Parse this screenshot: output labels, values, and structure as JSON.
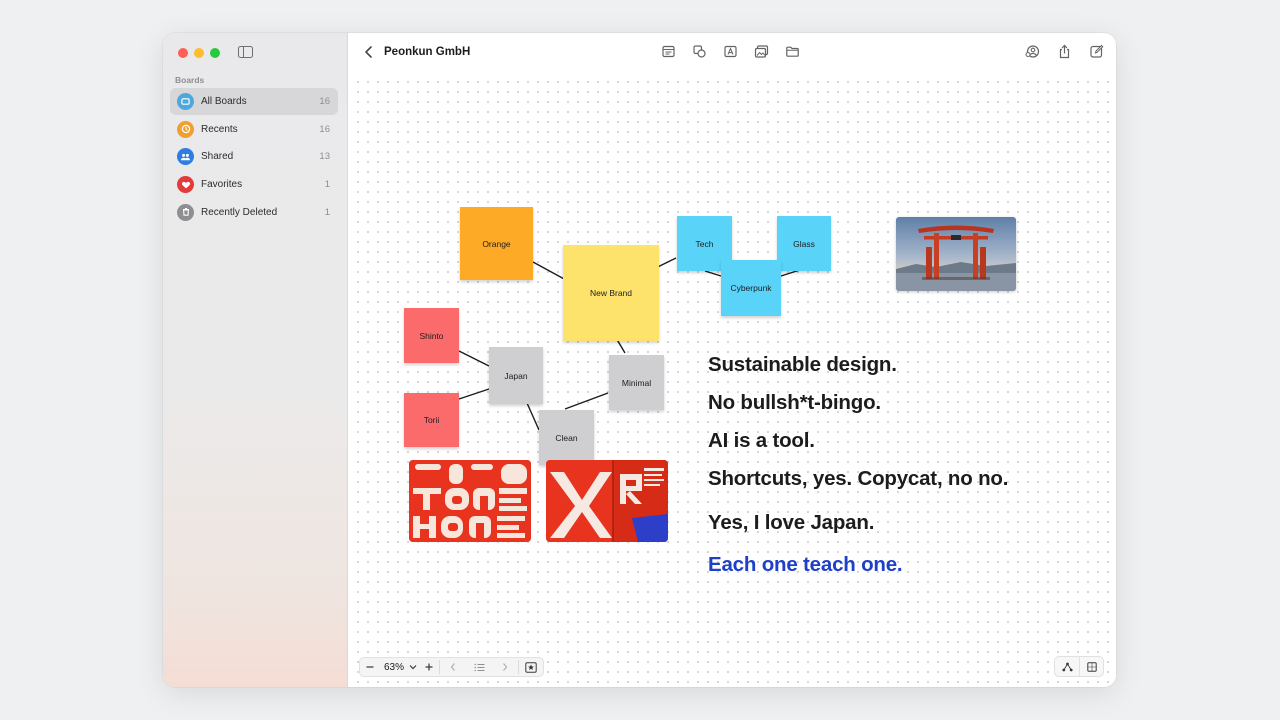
{
  "sidebar": {
    "section_label": "Boards",
    "items": [
      {
        "label": "All Boards",
        "count": "16",
        "icon": "all-boards-icon",
        "color": "#4ea8de"
      },
      {
        "label": "Recents",
        "count": "16",
        "icon": "clock-icon",
        "color": "#f0a030"
      },
      {
        "label": "Shared",
        "count": "13",
        "icon": "people-icon",
        "color": "#2f7de1"
      },
      {
        "label": "Favorites",
        "count": "1",
        "icon": "heart-icon",
        "color": "#e23b3b"
      },
      {
        "label": "Recently Deleted",
        "count": "1",
        "icon": "trash-icon",
        "color": "#8e8e93"
      }
    ]
  },
  "toolbar": {
    "title": "Peonkun GmbH"
  },
  "canvas": {
    "notes": {
      "orange": "Orange",
      "new_brand": "New Brand",
      "tech": "Tech",
      "glass": "Glass",
      "cyberpunk": "Cyberpunk",
      "shinto": "Shinto",
      "japan": "Japan",
      "minimal": "Minimal",
      "torii": "Torii",
      "clean": "Clean"
    },
    "statements": [
      "Sustainable design.",
      "No bullsh*t-bingo.",
      "AI is a tool.",
      "Shortcuts, yes. Copycat, no no.",
      "Yes, I love Japan.",
      "Each one teach one."
    ],
    "accent_color": "#1d3fc9"
  },
  "zoom": {
    "value": "63%"
  }
}
